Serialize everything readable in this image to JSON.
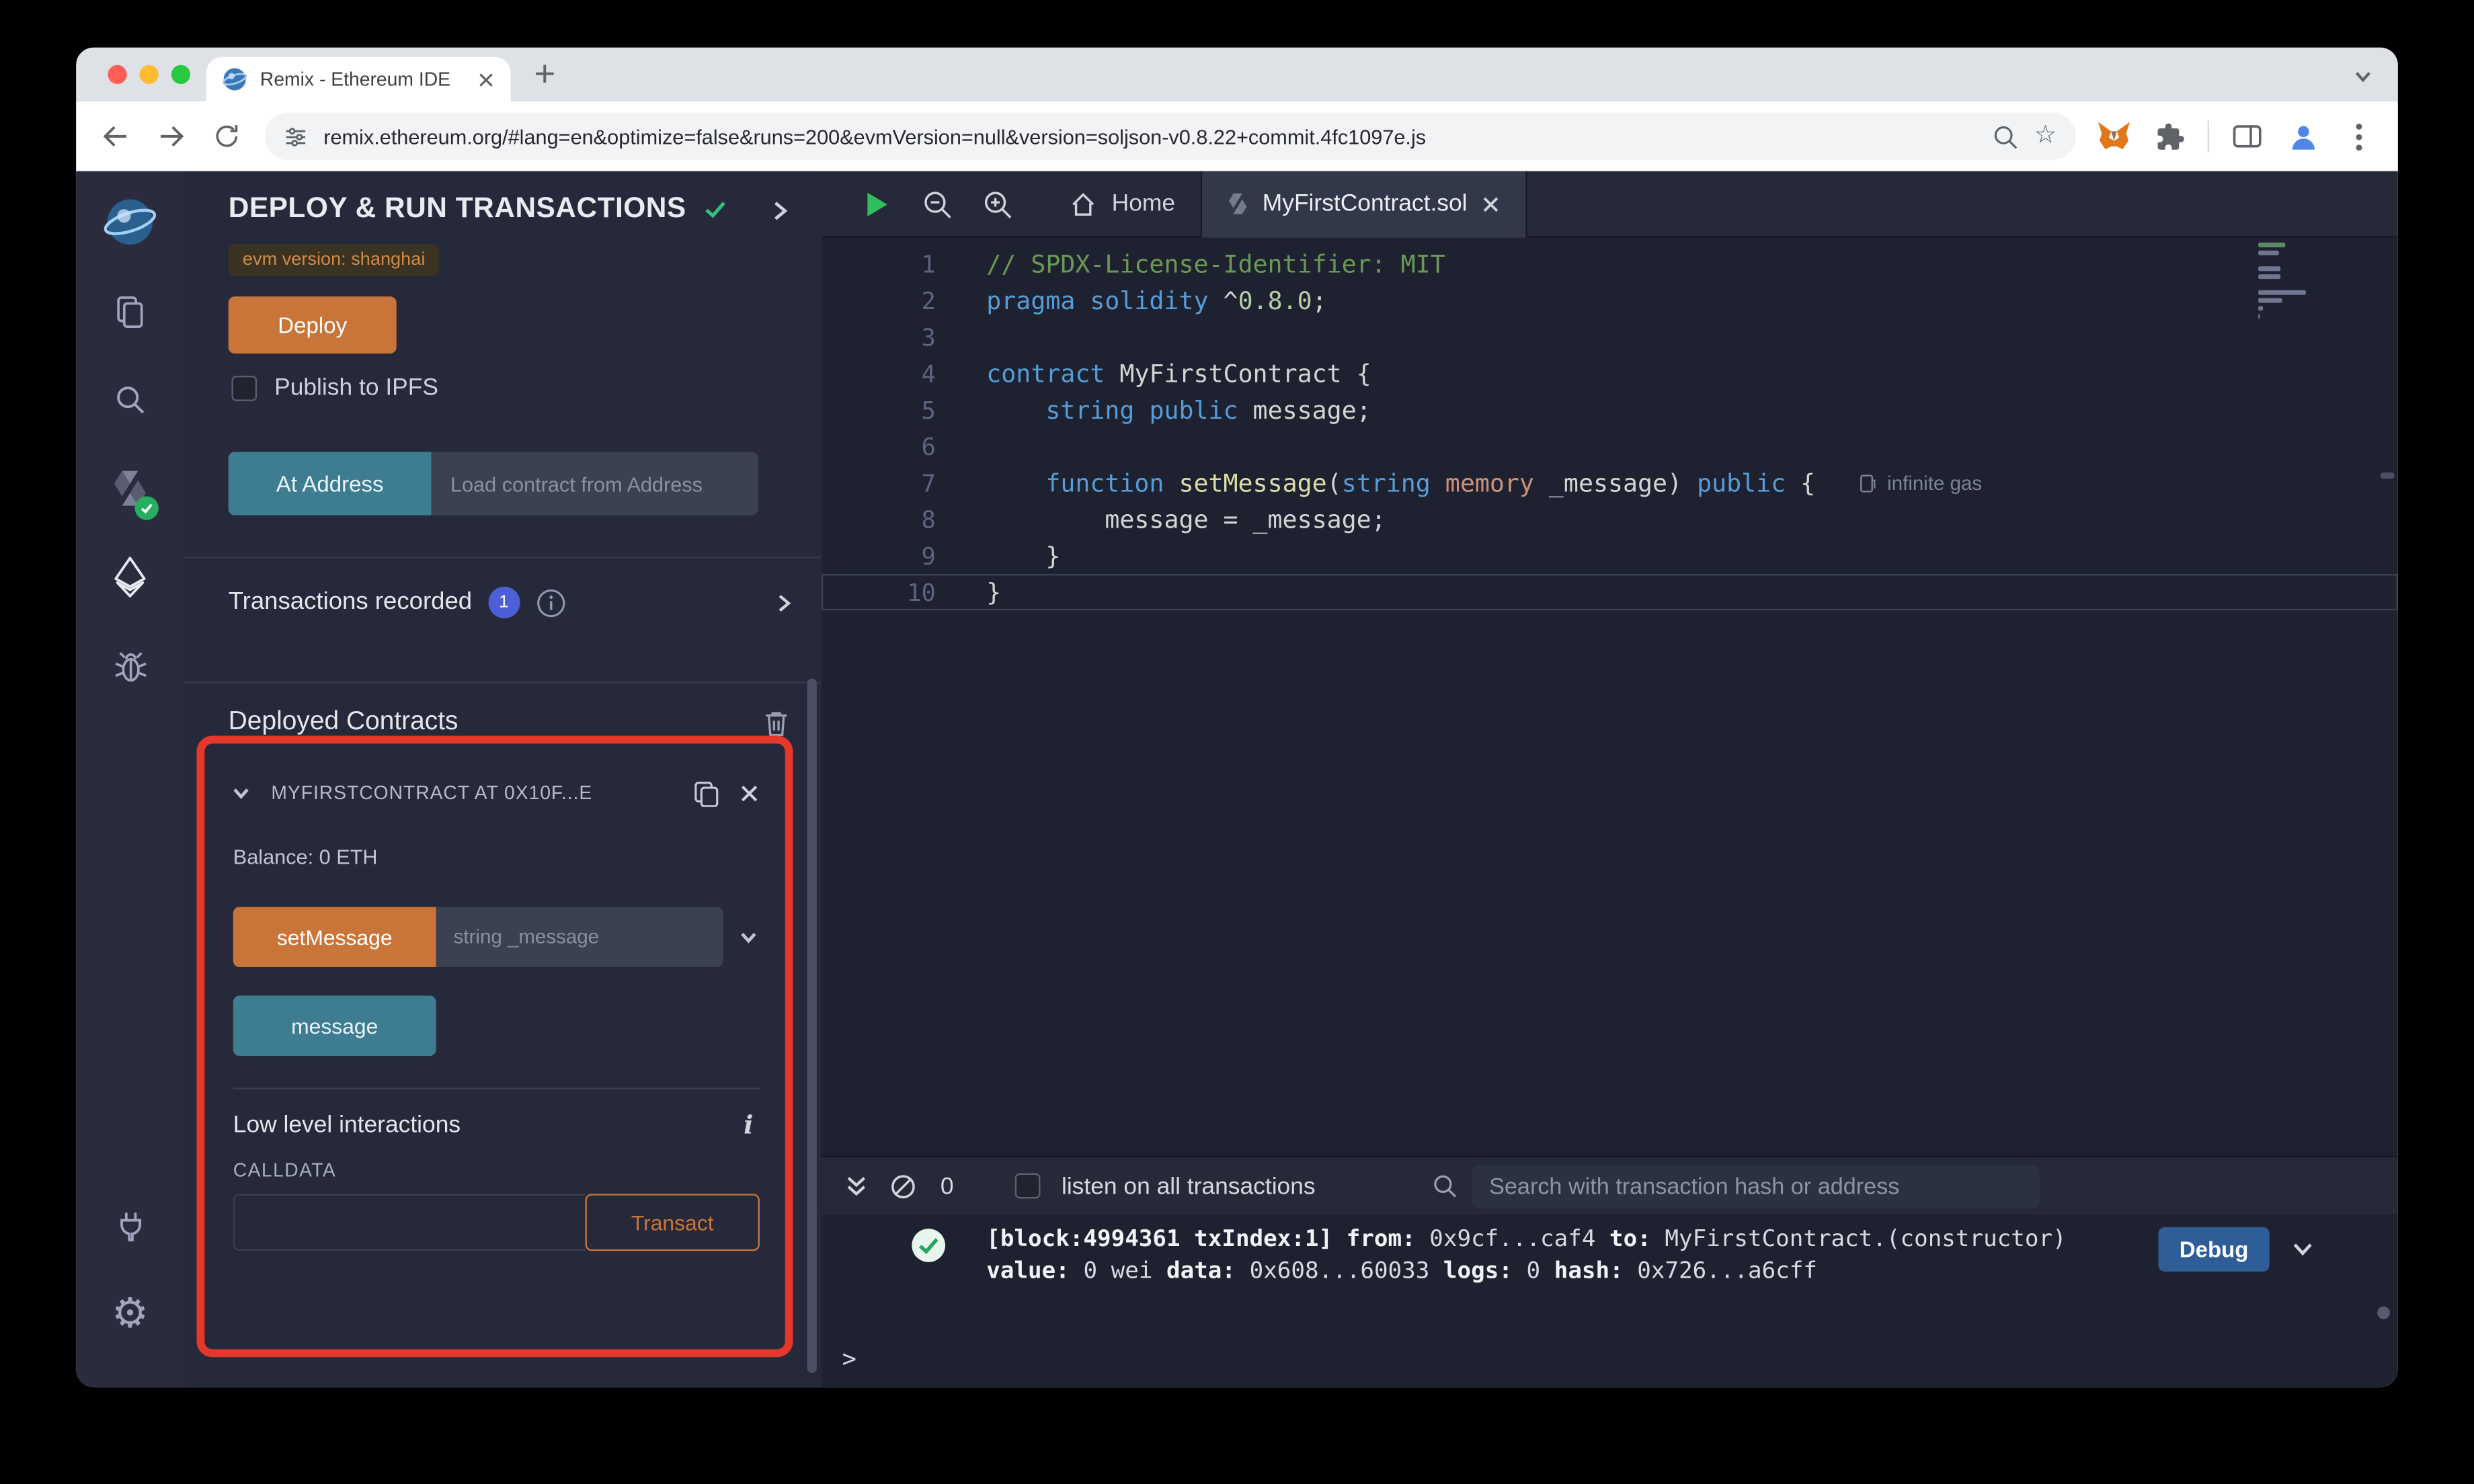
{
  "colors": {
    "accent_orange": "#c97539",
    "accent_teal": "#3e7c92",
    "highlight_red": "#e5382b",
    "debug_blue": "#2e5d97",
    "success_green": "#27ae60"
  },
  "browser": {
    "tab_title": "Remix - Ethereum IDE",
    "url": "remix.ethereum.org/#lang=en&optimize=false&runs=200&evmVersion=null&version=soljson-v0.8.22+commit.4fc1097e.js"
  },
  "side_panel": {
    "title": "DEPLOY & RUN TRANSACTIONS",
    "evm_badge": "evm version: shanghai",
    "deploy_button": "Deploy",
    "publish_to_ipfs": "Publish to IPFS",
    "at_address_button": "At Address",
    "at_address_placeholder": "Load contract from Address",
    "transactions_recorded_label": "Transactions recorded",
    "transactions_count": "1",
    "deployed_contracts_label": "Deployed Contracts",
    "contract_card": {
      "title": "MYFIRSTCONTRACT AT 0X10F...E",
      "balance": "Balance: 0 ETH",
      "set_message_button": "setMessage",
      "set_message_placeholder": "string _message",
      "message_button": "message",
      "low_level_label": "Low level interactions",
      "calldata_label": "CALLDATA",
      "transact_button": "Transact"
    }
  },
  "editor": {
    "tabs": [
      {
        "label": "Home"
      },
      {
        "label": "MyFirstContract.sol"
      }
    ],
    "gas_annotation": "infinite gas",
    "code_lines": [
      {
        "n": 1,
        "tokens": [
          {
            "t": "// SPDX-License-Identifier: MIT",
            "c": "cmt"
          }
        ]
      },
      {
        "n": 2,
        "tokens": [
          {
            "t": "pragma ",
            "c": "kw"
          },
          {
            "t": "solidity ",
            "c": "kw"
          },
          {
            "t": "^",
            "c": "pl"
          },
          {
            "t": "0.8.0",
            "c": "num"
          },
          {
            "t": ";",
            "c": "pl"
          }
        ]
      },
      {
        "n": 3,
        "tokens": []
      },
      {
        "n": 4,
        "tokens": [
          {
            "t": "contract ",
            "c": "kw"
          },
          {
            "t": "MyFirstContract {",
            "c": "pl"
          }
        ]
      },
      {
        "n": 5,
        "tokens": [
          {
            "t": "    ",
            "c": "pl"
          },
          {
            "t": "string ",
            "c": "kw"
          },
          {
            "t": "public ",
            "c": "kw"
          },
          {
            "t": "message;",
            "c": "pl"
          }
        ]
      },
      {
        "n": 6,
        "tokens": []
      },
      {
        "n": 7,
        "gas": true,
        "tokens": [
          {
            "t": "    ",
            "c": "pl"
          },
          {
            "t": "function ",
            "c": "kw"
          },
          {
            "t": "setMessage",
            "c": "fn"
          },
          {
            "t": "(",
            "c": "pl"
          },
          {
            "t": "string ",
            "c": "kw"
          },
          {
            "t": "memory",
            "c": "mem"
          },
          {
            "t": " _message) ",
            "c": "pl"
          },
          {
            "t": "public",
            "c": "kw"
          },
          {
            "t": " {",
            "c": "pl"
          }
        ]
      },
      {
        "n": 8,
        "tokens": [
          {
            "t": "        message = _message;",
            "c": "pl"
          }
        ]
      },
      {
        "n": 9,
        "tokens": [
          {
            "t": "    }",
            "c": "pl"
          }
        ]
      },
      {
        "n": 10,
        "current": true,
        "tokens": [
          {
            "t": "}",
            "c": "pl"
          }
        ]
      }
    ]
  },
  "terminal": {
    "count": "0",
    "listen_label": "listen on all transactions",
    "search_placeholder": "Search with transaction hash or address",
    "log_lines": [
      [
        {
          "t": "[block:4994361 txIndex:1]",
          "c": "b"
        },
        {
          "t": " ",
          "c": "p"
        },
        {
          "t": "from:",
          "c": "b"
        },
        {
          "t": " 0x9cf...caf4 ",
          "c": "p"
        },
        {
          "t": "to:",
          "c": "b"
        },
        {
          "t": " MyFirstContract.(constructor)",
          "c": "p"
        }
      ],
      [
        {
          "t": "value:",
          "c": "b"
        },
        {
          "t": " 0 wei ",
          "c": "p"
        },
        {
          "t": "data:",
          "c": "b"
        },
        {
          "t": " 0x608...60033 ",
          "c": "p"
        },
        {
          "t": "logs:",
          "c": "b"
        },
        {
          "t": " 0 ",
          "c": "p"
        },
        {
          "t": "hash:",
          "c": "b"
        },
        {
          "t": " 0x726...a6cff",
          "c": "p"
        }
      ]
    ],
    "debug_button": "Debug",
    "prompt": ">"
  }
}
